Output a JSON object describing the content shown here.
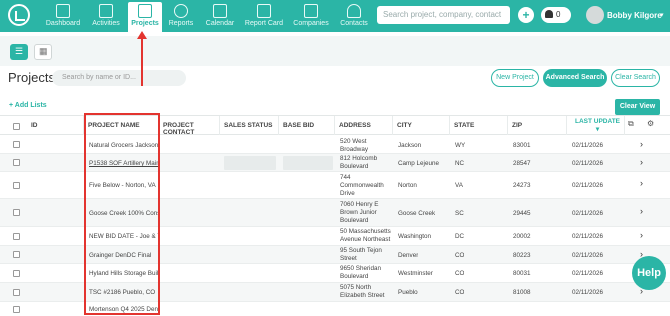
{
  "nav": {
    "items": [
      {
        "label": "Dashboard",
        "icon": "chart-icon"
      },
      {
        "label": "Activities",
        "icon": "flag-icon"
      },
      {
        "label": "Projects",
        "icon": "folder-icon"
      },
      {
        "label": "Reports",
        "icon": "target-icon"
      },
      {
        "label": "Calendar",
        "icon": "calendar-icon"
      },
      {
        "label": "Report Card",
        "icon": "report-card-icon"
      },
      {
        "label": "Companies",
        "icon": "building-icon"
      },
      {
        "label": "Contacts",
        "icon": "person-icon"
      }
    ],
    "active": "Projects",
    "search_placeholder": "Search project, company, contact",
    "add": "+",
    "notifications": "0",
    "user_name": "Bobby Kilgore",
    "caret": "▾"
  },
  "page": {
    "title": "Projects",
    "search_placeholder": "Search by name or ID...",
    "new_project": "New Project",
    "advanced_search": "Advanced Search",
    "clear_search": "Clear Search",
    "add_lists": "+ Add Lists",
    "clear_view": "Clear View"
  },
  "table": {
    "columns": [
      "ID",
      "PROJECT NAME",
      "PROJECT CONTACT",
      "SALES STATUS",
      "BASE BID",
      "ADDRESS",
      "CITY",
      "STATE",
      "ZIP",
      "LAST UPDATE"
    ],
    "rows": [
      {
        "name": "Natural Grocers Jackson,",
        "address": "520 West Broadway",
        "city": "Jackson",
        "state": "WY",
        "zip": "83001",
        "date": "02/11/2026"
      },
      {
        "name": "P1538 SOF Artillery Maint",
        "address": "812 Holcomb Boulevard",
        "city": "Camp Lejeune",
        "state": "NC",
        "zip": "28547",
        "date": "02/11/2026"
      },
      {
        "name": "Five Below - Norton, VA",
        "address": "744 Commonwealth Drive",
        "city": "Norton",
        "state": "VA",
        "zip": "24273",
        "date": "02/11/2026"
      },
      {
        "name": "Goose Creek 100% Const",
        "address": "7060 Henry E Brown Junior Boulevard",
        "city": "Goose Creek",
        "state": "SC",
        "zip": "29445",
        "date": "02/11/2026"
      },
      {
        "name": "NEW BID DATE - Joe & Th",
        "address": "50 Massachusetts Avenue Northeast",
        "city": "Washington",
        "state": "DC",
        "zip": "20002",
        "date": "02/11/2026"
      },
      {
        "name": "Grainger DenDC Final",
        "address": "95 South Tejon Street",
        "city": "Denver",
        "state": "CO",
        "zip": "80223",
        "date": "02/11/2026"
      },
      {
        "name": "Hyland Hills Storage Buil",
        "address": "9650 Sheridan Boulevard",
        "city": "Westminster",
        "state": "CO",
        "zip": "80031",
        "date": "02/11/2026"
      },
      {
        "name": "TSC #2186 Pueblo, CO",
        "address": "5075 North Elizabeth Street",
        "city": "Pueblo",
        "state": "CO",
        "zip": "81008",
        "date": "02/11/2026"
      },
      {
        "name": "Mortenson Q4 2025 Den",
        "address": "",
        "city": "",
        "state": "",
        "zip": "",
        "date": ""
      }
    ]
  },
  "help": "Help",
  "colors": {
    "accent": "#2bb5a6",
    "annotation": "#e3342f"
  }
}
